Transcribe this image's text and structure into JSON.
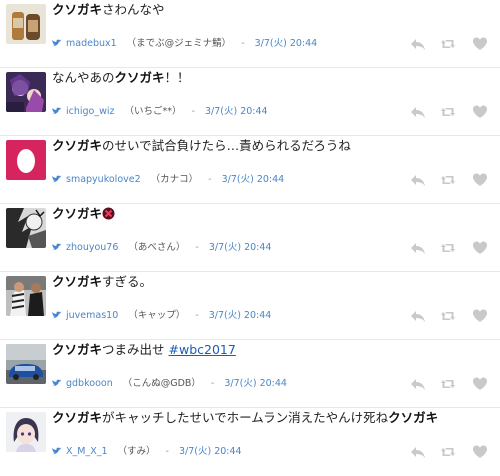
{
  "colors": {
    "link": "#4a86c8",
    "icon_gray": "#c9c9c9",
    "hashtag": "#1a5cb8"
  },
  "tweets": [
    {
      "pre": "",
      "bold": "クソガキ",
      "post": "さわんなや",
      "hashtag": "",
      "bold2": "",
      "username": "madebux1",
      "nickname": "（までぶ@ジェミナ鯖）",
      "sep": "-",
      "time": "3/7(火) 20:44"
    },
    {
      "pre": "なんやあの",
      "bold": "クソガキ",
      "post": "！！",
      "hashtag": "",
      "bold2": "",
      "username": "ichigo_wiz",
      "nickname": "（いちご**）",
      "sep": "-",
      "time": "3/7(火) 20:44"
    },
    {
      "pre": "",
      "bold": "クソガキ",
      "post": "のせいで試合負けたら…責められるだろうね",
      "hashtag": "",
      "bold2": "",
      "username": "smapyukolove2",
      "nickname": "（カナコ）",
      "sep": "-",
      "time": "3/7(火) 20:44"
    },
    {
      "pre": "",
      "bold": "クソガキ",
      "post": "",
      "hashtag": "",
      "bold2": "",
      "username": "zhouyou76",
      "nickname": "（あべさん）",
      "sep": "-",
      "time": "3/7(火) 20:44"
    },
    {
      "pre": "",
      "bold": "クソガキ",
      "post": "すぎる。",
      "hashtag": "",
      "bold2": "",
      "username": "juvemas10",
      "nickname": "（キャップ）",
      "sep": "-",
      "time": "3/7(火) 20:44"
    },
    {
      "pre": "",
      "bold": "クソガキ",
      "post": "つまみ出せ ",
      "hashtag": "#wbc2017",
      "bold2": "",
      "username": "gdbkooon",
      "nickname": "（こんぬ@GDB）",
      "sep": "-",
      "time": "3/7(火) 20:44"
    },
    {
      "pre": "",
      "bold": "クソガキ",
      "post": "がキャッチしたせいでホームラン消えたやんけ死ね",
      "hashtag": "",
      "bold2": "クソガキ",
      "username": "X_M_X_1",
      "nickname": "（すみ）",
      "sep": "-",
      "time": "3/7(火) 20:44"
    }
  ]
}
